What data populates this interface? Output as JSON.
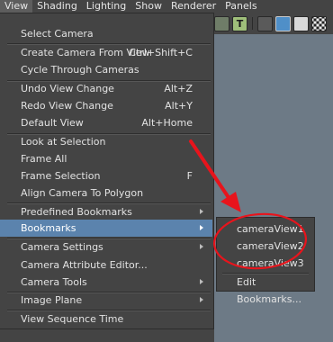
{
  "menubar": {
    "items": [
      "View",
      "Shading",
      "Lighting",
      "Show",
      "Renderer",
      "Panels"
    ]
  },
  "menu": {
    "items": [
      {
        "label": "Select Camera",
        "shortcut": ""
      },
      {
        "label": "Create Camera From View",
        "shortcut": "Ctrl+Shift+C"
      },
      {
        "label": "Cycle Through Cameras",
        "shortcut": ""
      },
      {
        "label": "Undo View Change",
        "shortcut": "Alt+Z"
      },
      {
        "label": "Redo View Change",
        "shortcut": "Alt+Y"
      },
      {
        "label": "Default View",
        "shortcut": "Alt+Home"
      },
      {
        "label": "Look at Selection",
        "shortcut": ""
      },
      {
        "label": "Frame All",
        "shortcut": ""
      },
      {
        "label": "Frame Selection",
        "shortcut": "F"
      },
      {
        "label": "Align Camera To Polygon",
        "shortcut": ""
      },
      {
        "label": "Predefined Bookmarks",
        "shortcut": ""
      },
      {
        "label": "Bookmarks",
        "shortcut": ""
      },
      {
        "label": "Camera Settings",
        "shortcut": ""
      },
      {
        "label": "Camera Attribute Editor...",
        "shortcut": ""
      },
      {
        "label": "Camera Tools",
        "shortcut": ""
      },
      {
        "label": "Image Plane",
        "shortcut": ""
      },
      {
        "label": "View Sequence Time",
        "shortcut": ""
      }
    ]
  },
  "submenu": {
    "items": [
      "cameraView1",
      "cameraView2",
      "cameraView3",
      "Edit Bookmarks..."
    ]
  },
  "toolbar": {
    "text_icon_label": "T"
  },
  "colors": {
    "menu_bg": "#444444",
    "highlight": "#5b83ad",
    "annotation": "#e8141c",
    "viewport": "#6d7a86"
  }
}
